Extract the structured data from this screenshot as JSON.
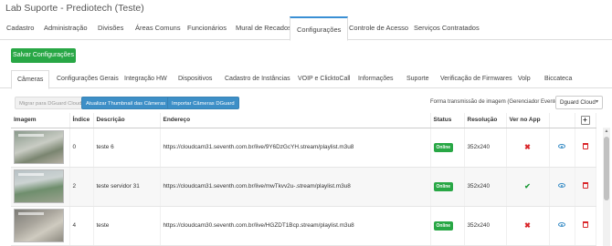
{
  "app": {
    "title": "Lab Suporte - Prediotech (Teste)"
  },
  "main_tabs": [
    {
      "label": "Cadastro"
    },
    {
      "label": "Administração"
    },
    {
      "label": "Divisões"
    },
    {
      "label": "Áreas Comuns"
    },
    {
      "label": "Funcionários"
    },
    {
      "label": "Mural de Recados"
    },
    {
      "label": "Configurações",
      "active": true
    },
    {
      "label": "Controle de Acesso"
    },
    {
      "label": "Serviços Contratados"
    }
  ],
  "save_button": {
    "label": "Salvar Configurações"
  },
  "sub_tabs": [
    {
      "label": "Câmeras",
      "active": true
    },
    {
      "label": "Configurações Gerais"
    },
    {
      "label": "Integração HW"
    },
    {
      "label": "Dispositivos"
    },
    {
      "label": "Cadastro de Instâncias"
    },
    {
      "label": "VOIP e ClicktoCall"
    },
    {
      "label": "Informações"
    },
    {
      "label": "Suporte"
    },
    {
      "label": "Verificação de Firmwares"
    },
    {
      "label": "Volp"
    },
    {
      "label": "Biccateca"
    }
  ],
  "toolbar": {
    "migrate_label": "Migrar para DGuard Cloud",
    "update_thumb_label": "Atualizar Thumbnail das Câmeras",
    "import_label": "Importar Câmeras DGuard",
    "mode_label": "Forma transmissão de imagem (Gerenciador Eventos)",
    "mode_value": "Dguard Cloud"
  },
  "table": {
    "headers": {
      "image": "Imagem",
      "index": "Índice",
      "description": "Descrição",
      "address": "Endereço",
      "status": "Status",
      "resolution": "Resolução",
      "app": "Ver no App",
      "add": "+"
    },
    "rows": [
      {
        "index": "0",
        "description": "teste 6",
        "address": "https://cloudcam31.seventh.com.br/live/9Y6DzGcYH.stream/playlist.m3u8",
        "status": "Online",
        "resolution": "352x240",
        "app": "✖"
      },
      {
        "index": "2",
        "description": "teste servidor 31",
        "address": "https://cloudcam31.seventh.com.br/live/mwTkvv2u-.stream/playlist.m3u8",
        "status": "Online",
        "resolution": "352x240",
        "app": "✔"
      },
      {
        "index": "4",
        "description": "teste",
        "address": "https://cloudcam30.seventh.com.br/live/HGZDT1Bcp.stream/playlist.m3u8",
        "status": "Online",
        "resolution": "352x240",
        "app": "✖"
      }
    ]
  },
  "colors": {
    "accent": "#3d8fc7",
    "success": "#28a745",
    "danger": "#d9262a"
  }
}
